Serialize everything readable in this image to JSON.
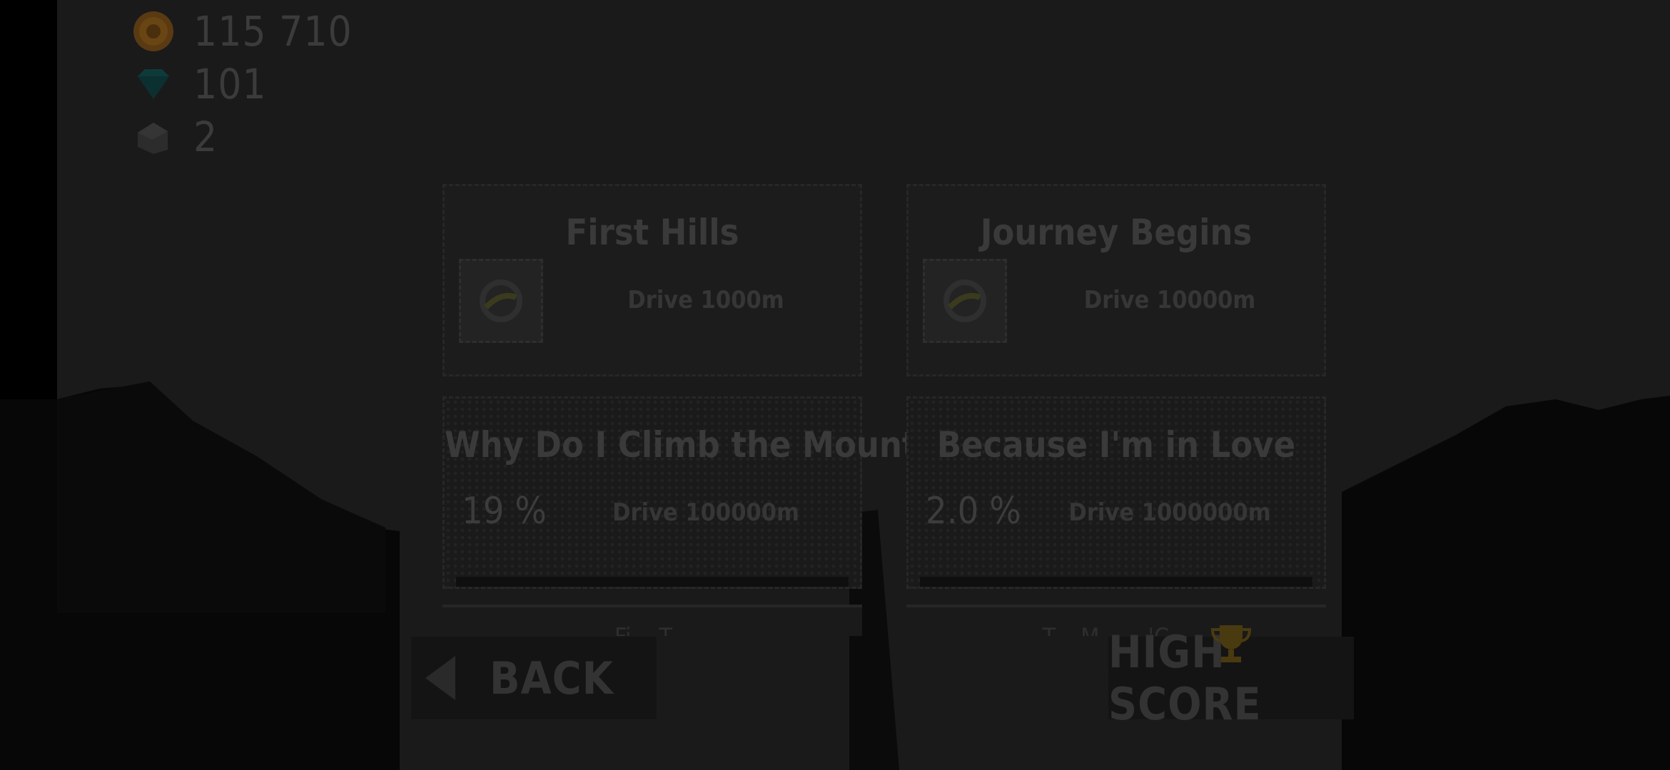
{
  "currency": {
    "coins": "115 710",
    "gems": "101",
    "fuel_items": "2"
  },
  "achievements": [
    {
      "title": "First Hills",
      "task": "Drive 1000m",
      "status": "completed"
    },
    {
      "title": "Journey Begins",
      "task": "Drive 10000m",
      "status": "completed"
    },
    {
      "title": "Why Do I Climb the Mountain?",
      "progress": "19 %",
      "task": "Drive 100000m",
      "status": "in-progress"
    },
    {
      "title": "Because I'm in Love",
      "progress": "2.0 %",
      "task": "Drive 1000000m",
      "status": "in-progress"
    }
  ],
  "partial_rows": [
    {
      "title": "Fi... T..."
    },
    {
      "title": "T... M... ...'C..."
    }
  ],
  "buttons": {
    "back": "BACK",
    "high_score": "HIGH SCORE"
  },
  "icons": {
    "coin": "coin-icon",
    "gem": "gem-icon",
    "fuel": "fuel-can-icon",
    "badge": "achievement-badge-icon",
    "back_arrow": "back-arrow-icon",
    "trophy": "trophy-icon"
  },
  "colors": {
    "overlay": "#1a1a1a",
    "coin": "#5a3a12",
    "gem": "#0f3a3a",
    "trophy": "#4a3a10"
  }
}
